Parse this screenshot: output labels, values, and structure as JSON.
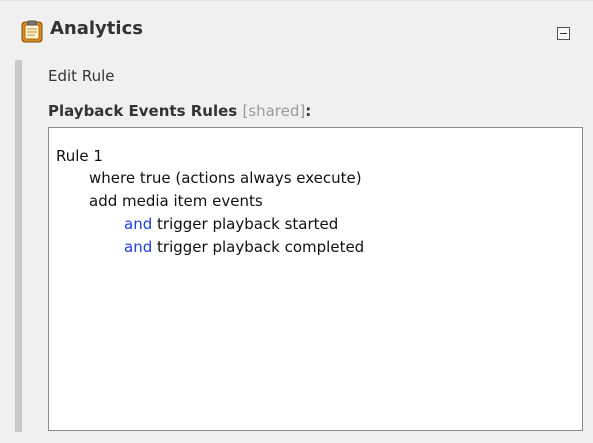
{
  "panel": {
    "title": "Analytics",
    "icon": "clipboard-icon",
    "collapse_icon": "collapse-minus-icon"
  },
  "editor": {
    "edit_rule_label": "Edit Rule",
    "section_title": "Playback Events Rules",
    "shared_tag": "[shared]",
    "title_suffix": ":",
    "rule": {
      "name": "Rule 1",
      "condition": "where true (actions always execute)",
      "action": "add media item events",
      "triggers": [
        {
          "keyword": "and",
          "text": "trigger playback started"
        },
        {
          "keyword": "and",
          "text": "trigger playback completed"
        }
      ]
    }
  },
  "colors": {
    "keyword": "#1f3ee8",
    "shared_tag": "#9a9a9a",
    "panel_bg": "#f0f0f0"
  }
}
